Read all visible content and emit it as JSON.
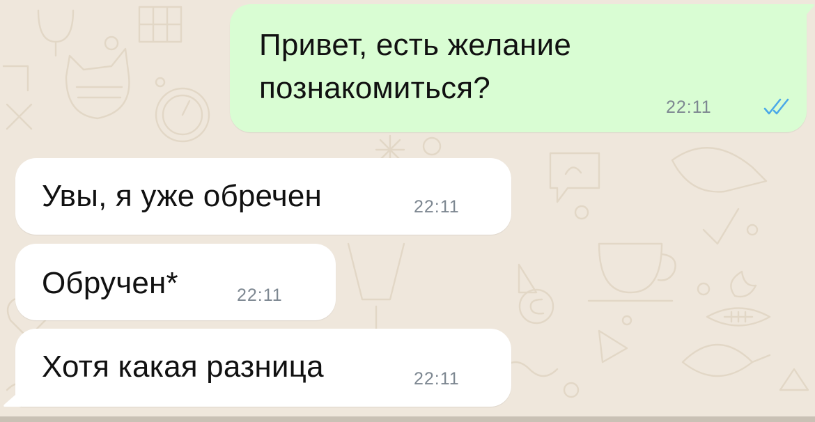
{
  "chat": {
    "messages": [
      {
        "direction": "outgoing",
        "lines": [
          "Привет, есть желание",
          "познакомиться?"
        ],
        "time": "22:11",
        "status": "read"
      },
      {
        "direction": "incoming",
        "text": "Увы, я уже обречен",
        "time": "22:11"
      },
      {
        "direction": "incoming",
        "text": "Обручен*",
        "time": "22:11"
      },
      {
        "direction": "incoming",
        "text": "Хотя какая разница",
        "time": "22:11"
      }
    ]
  },
  "colors": {
    "wallpaper": "#efe7dc",
    "outgoing_bubble": "#d9fdd3",
    "incoming_bubble": "#ffffff",
    "timestamp": "#7d8791",
    "read_ticks": "#4aa8e8"
  },
  "icons": {
    "read_receipt": "double-check-icon"
  }
}
